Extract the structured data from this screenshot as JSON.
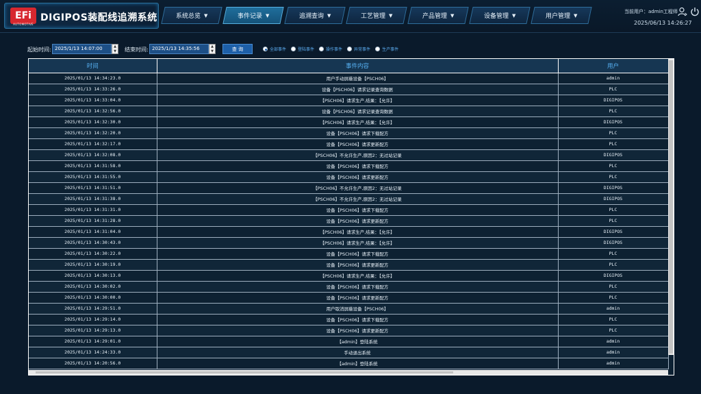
{
  "app": {
    "logo_text": "EFi",
    "logo_sub": "AUTOMOTIVE",
    "title": "DIGIPOS装配线追溯系统"
  },
  "nav": [
    {
      "label": "系统总览",
      "active": false
    },
    {
      "label": "事件记录",
      "active": true
    },
    {
      "label": "追溯查询",
      "active": false
    },
    {
      "label": "工艺管理",
      "active": false
    },
    {
      "label": "产品管理",
      "active": false
    },
    {
      "label": "设备管理",
      "active": false
    },
    {
      "label": "用户管理",
      "active": false
    }
  ],
  "header": {
    "current_user": "当前用户：admin工程师",
    "datetime": "2025/06/13 14:26:27"
  },
  "filter": {
    "start_label": "起始时间:",
    "start_value": "2025/1/13 14:07:00",
    "end_label": "结束时间:",
    "end_value": "2025/1/13 14:35:56",
    "query_label": "查 询",
    "radios": [
      {
        "label": "全部事件",
        "checked": true
      },
      {
        "label": "登陆事件",
        "checked": false
      },
      {
        "label": "操作事件",
        "checked": false
      },
      {
        "label": "异常事件",
        "checked": false
      },
      {
        "label": "生产事件",
        "checked": false
      }
    ]
  },
  "table": {
    "columns": [
      "时间",
      "事件内容",
      "用户"
    ],
    "rows": [
      [
        "2025/01/13 14:34:23.0",
        "用户手动屏蔽设备【PSCH06】",
        "admin"
      ],
      [
        "2025/01/13 14:33:26.0",
        "设备【PSCH06】请求记录查询数据",
        "PLC"
      ],
      [
        "2025/01/13 14:33:04.0",
        "【PSCH06】请求生产,结果：【允许】",
        "DIGIPOS"
      ],
      [
        "2025/01/13 14:32:56.0",
        "设备【PSCH06】请求记录查询数据",
        "PLC"
      ],
      [
        "2025/01/13 14:32:30.0",
        "【PSCH06】请求生产,结果：【允许】",
        "DIGIPOS"
      ],
      [
        "2025/01/13 14:32:20.0",
        "设备【PSCH06】请求下载配方",
        "PLC"
      ],
      [
        "2025/01/13 14:32:17.0",
        "设备【PSCH06】请求更新配方",
        "PLC"
      ],
      [
        "2025/01/13 14:32:08.0",
        "【PSCH06】不允许生产,原因2：无过站记录",
        "DIGIPOS"
      ],
      [
        "2025/01/13 14:31:58.0",
        "设备【PSCH06】请求下载配方",
        "PLC"
      ],
      [
        "2025/01/13 14:31:55.0",
        "设备【PSCH06】请求更新配方",
        "PLC"
      ],
      [
        "2025/01/13 14:31:51.0",
        "【PSCH06】不允许生产,原因2：无过站记录",
        "DIGIPOS"
      ],
      [
        "2025/01/13 14:31:38.0",
        "【PSCH06】不允许生产,原因2：无过站记录",
        "DIGIPOS"
      ],
      [
        "2025/01/13 14:31:31.0",
        "设备【PSCH06】请求下载配方",
        "PLC"
      ],
      [
        "2025/01/13 14:31:28.0",
        "设备【PSCH06】请求更新配方",
        "PLC"
      ],
      [
        "2025/01/13 14:31:04.0",
        "【PSCH06】请求生产,结果：【允许】",
        "DIGIPOS"
      ],
      [
        "2025/01/13 14:30:43.0",
        "【PSCH06】请求生产,结果：【允许】",
        "DIGIPOS"
      ],
      [
        "2025/01/13 14:30:22.0",
        "设备【PSCH06】请求下载配方",
        "PLC"
      ],
      [
        "2025/01/13 14:30:19.0",
        "设备【PSCH06】请求更新配方",
        "PLC"
      ],
      [
        "2025/01/13 14:30:13.0",
        "【PSCH06】请求生产,结果：【允许】",
        "DIGIPOS"
      ],
      [
        "2025/01/13 14:30:02.0",
        "设备【PSCH06】请求下载配方",
        "PLC"
      ],
      [
        "2025/01/13 14:30:00.0",
        "设备【PSCH06】请求更新配方",
        "PLC"
      ],
      [
        "2025/01/13 14:29:51.0",
        "用户取消屏蔽设备【PSCH06】",
        "admin"
      ],
      [
        "2025/01/13 14:29:14.0",
        "设备【PSCH06】请求下载配方",
        "PLC"
      ],
      [
        "2025/01/13 14:29:13.0",
        "设备【PSCH06】请求更新配方",
        "PLC"
      ],
      [
        "2025/01/13 14:29:01.0",
        "【admin】登陆系统",
        "admin"
      ],
      [
        "2025/01/13 14:24:33.0",
        "手动退出系统",
        "admin"
      ],
      [
        "2025/01/13 14:20:56.0",
        "【admin】登陆系统",
        "admin"
      ]
    ]
  }
}
